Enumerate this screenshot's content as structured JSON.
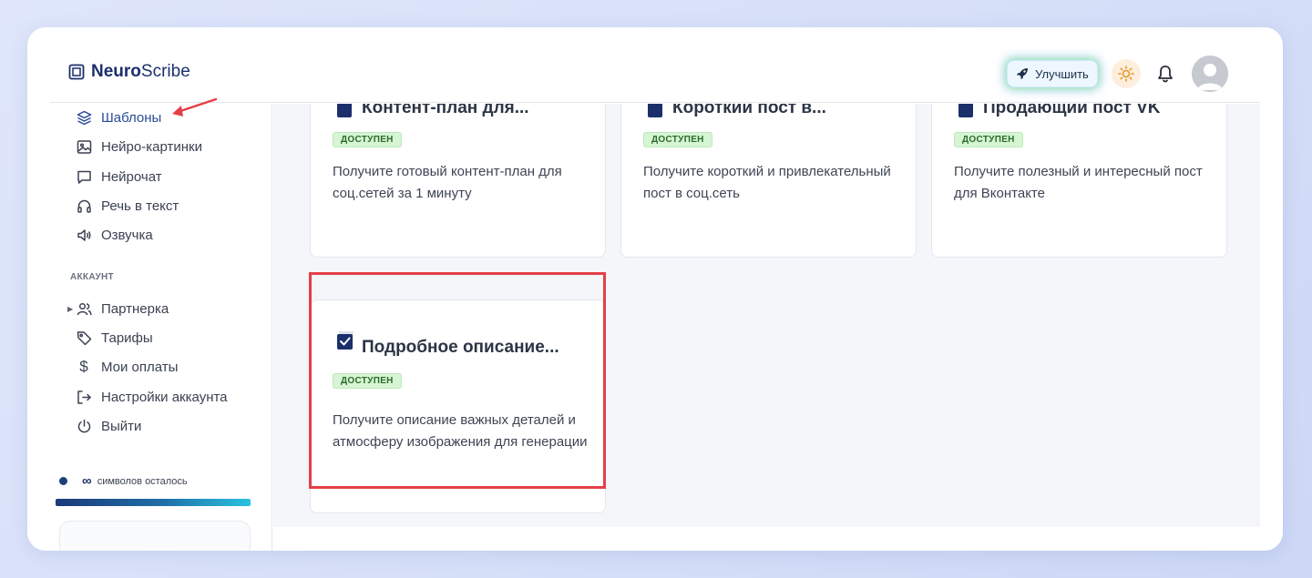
{
  "app": {
    "logo_bold": "Neuro",
    "logo_rest": "Scribe"
  },
  "header": {
    "upgrade_label": "Улучшить",
    "icons": [
      "rocket-icon",
      "sun-icon",
      "bell-icon",
      "avatar"
    ]
  },
  "sidebar": {
    "items": [
      {
        "label": "Шаблоны",
        "icon": "layers-icon",
        "active": true
      },
      {
        "label": "Нейро-картинки",
        "icon": "image-icon"
      },
      {
        "label": "Нейрочат",
        "icon": "chat-icon"
      },
      {
        "label": "Речь в текст",
        "icon": "headphones-icon"
      },
      {
        "label": "Озвучка",
        "icon": "speaker-icon"
      }
    ],
    "account_label": "АККАУНТ",
    "account_items": [
      {
        "label": "Партнерка",
        "icon": "users-icon"
      },
      {
        "label": "Тарифы",
        "icon": "tag-icon"
      },
      {
        "label": "Мои оплаты",
        "icon": "dollar-icon"
      },
      {
        "label": "Настройки аккаунта",
        "icon": "login-arrow-icon"
      },
      {
        "label": "Выйти",
        "icon": "power-icon"
      }
    ],
    "chars_symbol": "∞",
    "chars_label": "символов осталось"
  },
  "cards": [
    {
      "title": "Контент-план для...",
      "badge": "ДОСТУПЕН",
      "desc": "Получите готовый контент-план для соц.сетей за 1 минуту"
    },
    {
      "title": "Короткий пост в...",
      "badge": "ДОСТУПЕН",
      "desc": "Получите короткий и привлекательный пост в соц.сеть"
    },
    {
      "title": "Продающий пост VK",
      "badge": "ДОСТУПЕН",
      "desc": "Получите полезный и интересный пост для Вконтакте"
    },
    {
      "title": "Подробное описание...",
      "badge": "ДОСТУПЕН",
      "desc": "Получите описание важных деталей и атмосферу изображения для генерации"
    }
  ],
  "colors": {
    "accent": "#1b2f6b",
    "badge_bg": "#d6f5d3",
    "highlight": "#e53f46",
    "annotation_arrow": "#e53f46"
  }
}
